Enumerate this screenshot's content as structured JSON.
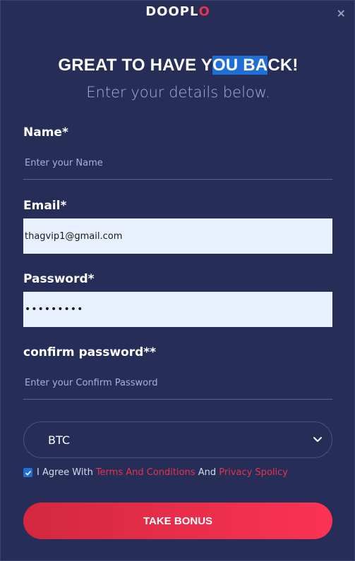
{
  "header": {
    "logo_main": "DOOPL",
    "logo_accent": "O",
    "close_symbol": "×"
  },
  "title": {
    "part1": "GREAT TO HAVE Y",
    "highlighted": "OU BA",
    "part2": "CK!",
    "subtitle": "Enter your details below."
  },
  "form": {
    "name": {
      "label": "Name*",
      "placeholder": "Enter your Name",
      "value": ""
    },
    "email": {
      "label": "Email*",
      "value": "thagvip1@gmail.com"
    },
    "password": {
      "label": "Password*",
      "value": "•••••••••"
    },
    "confirm_password": {
      "label": "confirm password**",
      "placeholder": "Enter your Confirm Password",
      "value": ""
    },
    "currency": {
      "selected": "BTC"
    },
    "agree": {
      "checked": true,
      "text1": "I Agree With ",
      "link1": "Terms And Conditions",
      "text2": " And ",
      "link2": "Privacy Spolicy"
    },
    "submit_label": "TAKE BONUS"
  },
  "colors": {
    "background": "#262d56",
    "accent": "#e5334d",
    "highlight": "#1f6fd6"
  }
}
